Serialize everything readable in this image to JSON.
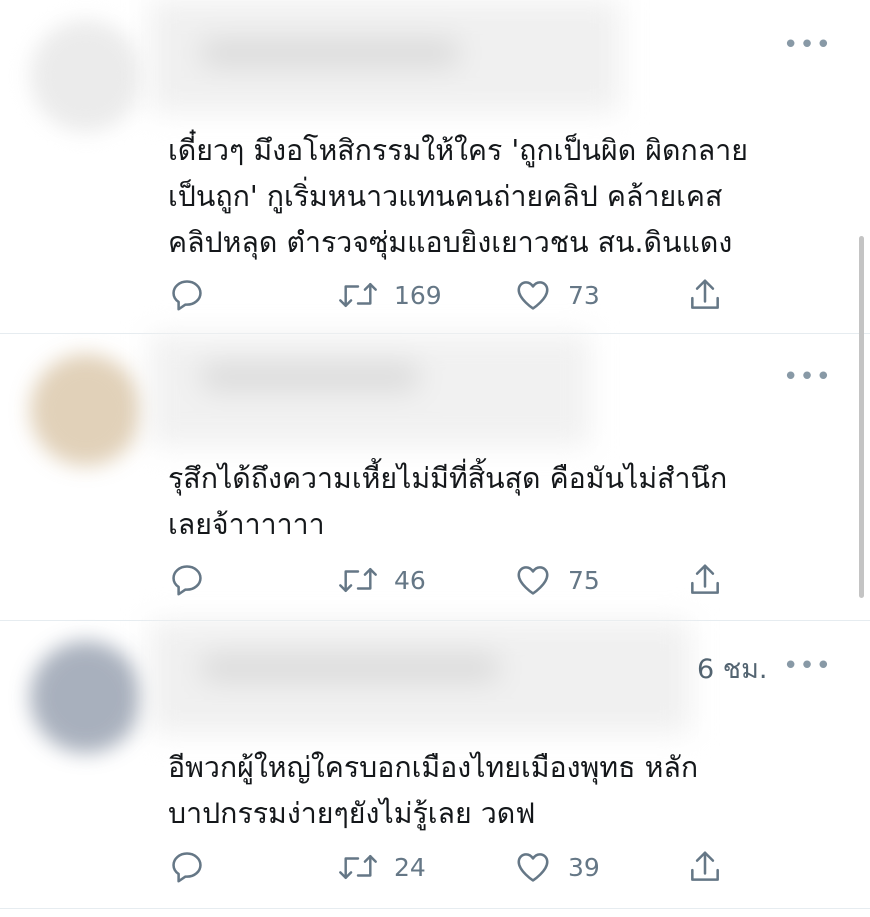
{
  "replies": [
    {
      "time": "",
      "text_lines": [
        "เดี๋ยวๆ มึงอโหสิกรรมให้ใคร 'ถูกเป็นผิด ผิดกลาย",
        "เป็นถูก' กูเริ่มหนาวแทนคนถ่ายคลิป คล้ายเคส",
        "คลิปหลุด ตำรวจซุ่มแอบยิงเยาวชน สน.ดินแดง"
      ],
      "retweets": "169",
      "likes": "73"
    },
    {
      "time": "",
      "text_lines": [
        "รุสึกได้ถึงความเหี้ยไม่มีที่สิ้นสุด คือมันไม่สำนึก",
        "เลยจ้าาาาาา"
      ],
      "retweets": "46",
      "likes": "75"
    },
    {
      "time": "6 ชม.",
      "text_lines": [
        "อีพวกผู้ใหญ่ใครบอกเมืองไทยเมืองพุทธ  หลัก",
        "บาปกรรมง่ายๆยังไม่รู้เลย วดฟ"
      ],
      "retweets": "24",
      "likes": "39"
    }
  ],
  "more_glyph": "•••",
  "icons": [
    "reply-icon",
    "retweet-icon",
    "like-icon",
    "share-icon",
    "more-icon"
  ],
  "colors": {
    "text": "#14171a",
    "muted": "#657786",
    "divider": "#e6ecf0"
  }
}
